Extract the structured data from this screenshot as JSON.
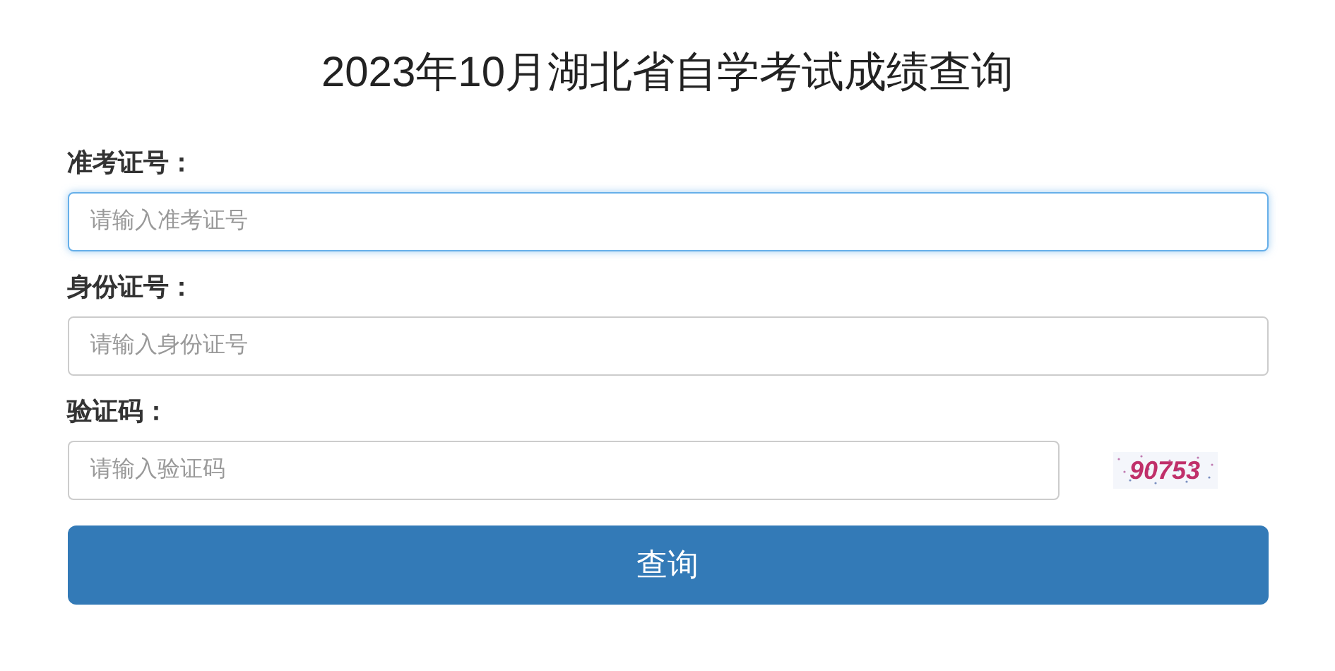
{
  "title": "2023年10月湖北省自学考试成绩查询",
  "fields": [
    {
      "kind": "text",
      "label": "准考证号：",
      "placeholder": "请输入准考证号",
      "focused": true
    },
    {
      "kind": "text",
      "label": "身份证号：",
      "placeholder": "请输入身份证号",
      "focused": false
    },
    {
      "kind": "captcha",
      "label": "验证码：",
      "placeholder": "请输入验证码",
      "focused": false,
      "captcha": "90753"
    }
  ],
  "submit": "查询"
}
